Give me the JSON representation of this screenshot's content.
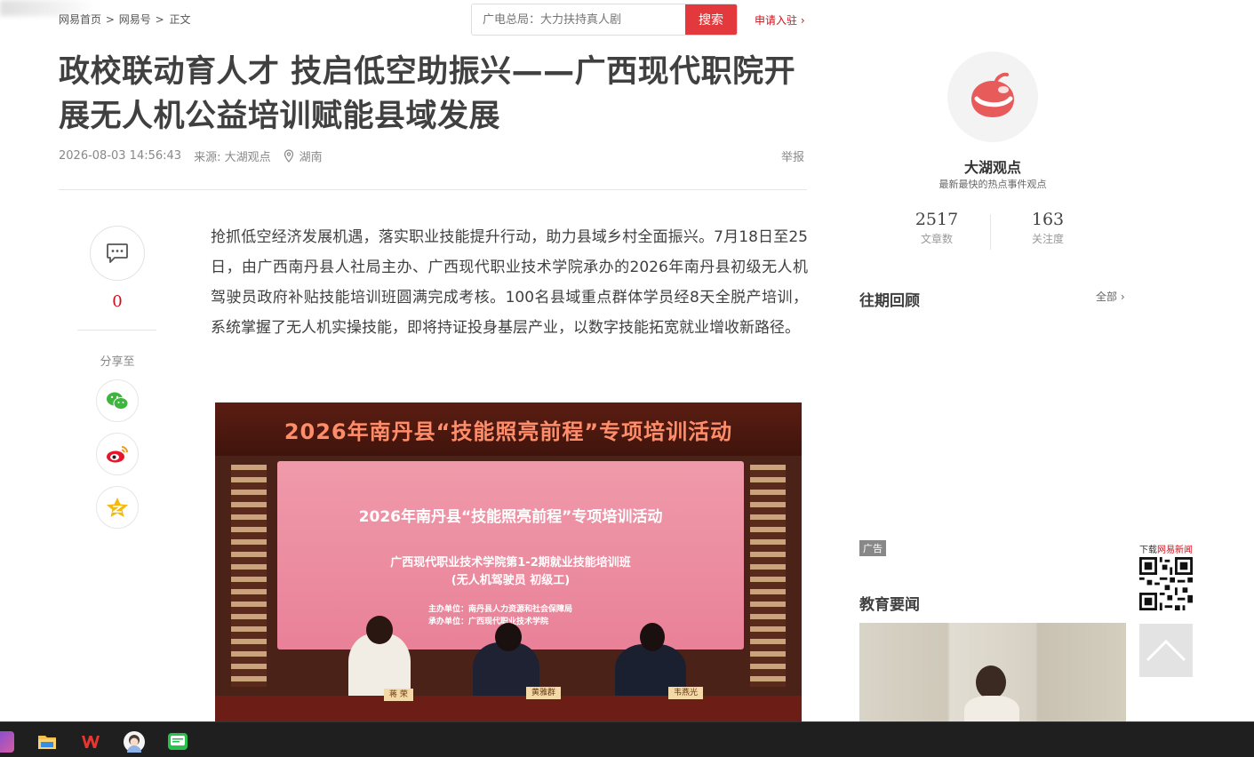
{
  "breadcrumb": {
    "home": "网易首页",
    "sep1": ">",
    "netease_hao": "网易号",
    "sep2": ">",
    "current": "正文"
  },
  "search": {
    "placeholder": "广电总局：大力扶持真人剧",
    "button": "搜索"
  },
  "apply_label": "申请入驻",
  "article": {
    "title": "政校联动育人才 技启低空助振兴——广西现代职院开展无人机公益培训赋能县域发展",
    "datetime": "2026-08-03 14:56:43",
    "source": "来源: 大湖观点",
    "location": "湖南",
    "report": "举报",
    "lead": "抢抓低空经济发展机遇，落实职业技能提升行动，助力县域乡村全面振兴。7月18日至25日，由广西南丹县人社局主办、广西现代职业技术学院承办的2026年南丹县初级无人机驾驶员政府补贴技能培训班圆满完成考核。100名县域重点群体学员经8天全脱产培训，系统掌握了无人机实操技能，即将持证投身基层产业，以数字技能拓宽就业增收新路径。"
  },
  "photo": {
    "banner": "2026年南丹县“技能照亮前程”专项培训活动",
    "screen_title": "2026年南丹县“技能照亮前程”专项培训活动",
    "screen_sub1": "广西现代职业技术学院第1-2期就业技能培训班",
    "screen_sub2": "(无人机驾驶员 初级工)",
    "screen_host": "主办单位：南丹县人力资源和社会保障局",
    "screen_org": "承办单位：广西现代职业技术学院",
    "plaque1": "蒋 荣",
    "plaque2": "黄雅群",
    "plaque3": "韦燕光"
  },
  "sidebar_left": {
    "comment_count": "0",
    "share_label": "分享至"
  },
  "author": {
    "name": "大湖观点",
    "desc": "最新最快的热点事件观点",
    "articles": "2517",
    "articles_label": "文章数",
    "followers": "163",
    "followers_label": "关注度"
  },
  "past": {
    "title": "往期回顾",
    "all": "全部"
  },
  "ad": {
    "label": "广告",
    "download_prefix": "下载",
    "download_app": "网易新闻"
  },
  "education": {
    "title": "教育要闻"
  },
  "colors": {
    "brand_red": "#d0111b",
    "search_red": "#e4393c"
  }
}
